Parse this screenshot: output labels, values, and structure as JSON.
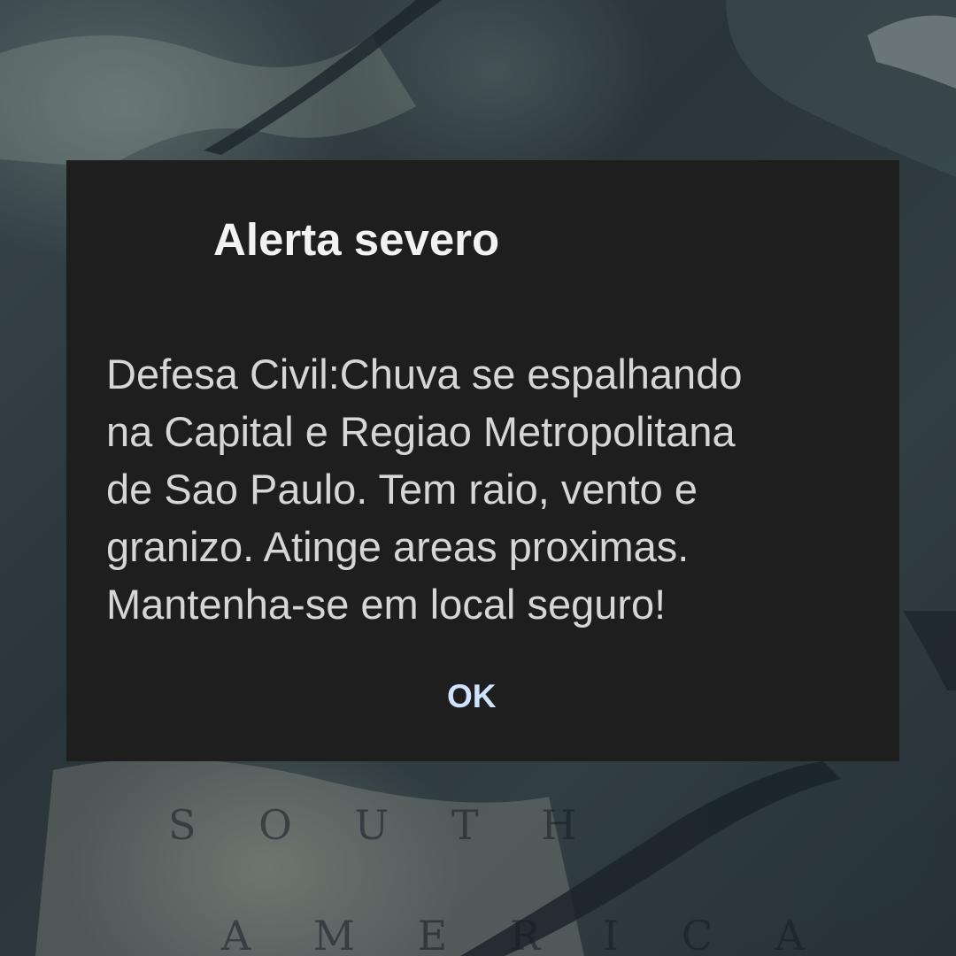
{
  "dialog": {
    "title": "Alerta severo",
    "message_lines": [
      "Defesa Civil:Chuva se espalhando",
      "na Capital e Regiao Metropolitana",
      "de Sao Paulo. Tem raio, vento e",
      "granizo. Atinge areas proximas.",
      "Mantenha-se em local seguro!"
    ],
    "ok_label": "OK"
  },
  "wallpaper": {
    "map_labels": [
      "S O U T H",
      "A M E R I C A"
    ],
    "colors": {
      "background": "#2b363b",
      "dialog_background": "#1e1e1f",
      "title_text": "#f2f2f2",
      "message_text": "#d6d6d6",
      "ok_text": "#cfe3ff"
    }
  }
}
